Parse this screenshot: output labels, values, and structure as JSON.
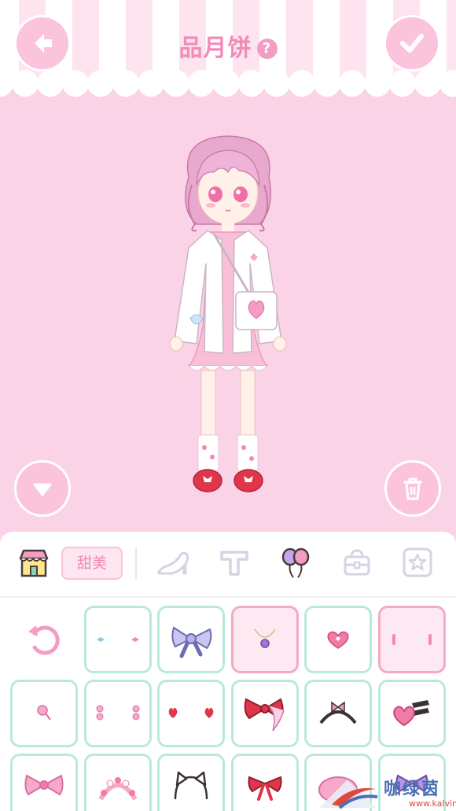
{
  "header": {
    "title": "品月饼",
    "help_glyph": "?"
  },
  "buttons": {
    "back_icon": "arrow-left-icon",
    "confirm_icon": "check-icon",
    "collapse_icon": "triangle-down-icon",
    "delete_icon": "trash-icon"
  },
  "tabs": {
    "style_tag": "甜美",
    "items": [
      "shop-icon",
      "shoe-icon",
      "t-shirt-icon",
      "balloons-icon",
      "bag-icon",
      "star-icon"
    ]
  },
  "accessories": [
    {
      "icon": "reset-icon",
      "selected": false
    },
    {
      "icon": "tiny-bows-icon",
      "selected": false
    },
    {
      "icon": "lavender-bow-icon",
      "selected": false
    },
    {
      "icon": "pendant-necklace-icon",
      "selected": true
    },
    {
      "icon": "heart-brooch-icon",
      "selected": false
    },
    {
      "icon": "tiny-earrings-icon",
      "selected": true
    },
    {
      "icon": "lollipop-icon",
      "selected": false
    },
    {
      "icon": "bear-earrings-icon",
      "selected": false
    },
    {
      "icon": "heart-earrings-icon",
      "selected": false
    },
    {
      "icon": "red-bow-clip-icon",
      "selected": false
    },
    {
      "icon": "headband-icon",
      "selected": false
    },
    {
      "icon": "heart-clip-icon",
      "selected": false
    },
    {
      "icon": "pink-bow-icon",
      "selected": false
    },
    {
      "icon": "flower-crown-icon",
      "selected": false
    },
    {
      "icon": "cat-ear-hat-icon",
      "selected": false
    },
    {
      "icon": "ribbon-bow-icon",
      "selected": false
    },
    {
      "icon": "beret-icon",
      "selected": false
    },
    {
      "icon": "purple-bow-icon",
      "selected": false
    }
  ],
  "watermark": {
    "text": "咖绿茵",
    "url": "www.kalvin.cn"
  },
  "colors": {
    "background": "#fbd3e6",
    "accent_pink": "#f28bb9",
    "cell_border": "#b9ead9",
    "selected_border": "#f5a8c8"
  }
}
